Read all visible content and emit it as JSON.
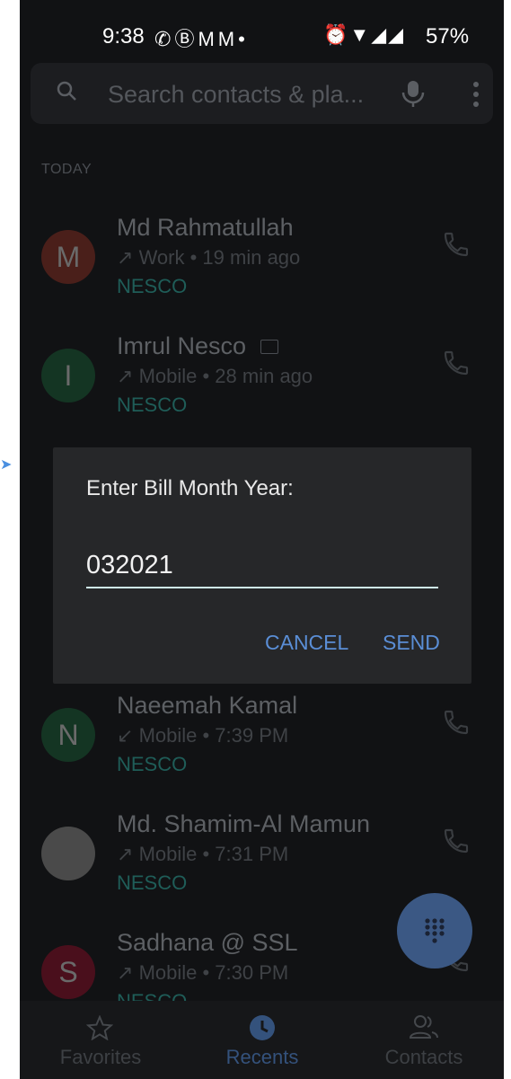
{
  "status_bar": {
    "time": "9:38",
    "battery": "57%",
    "left_icons": [
      "whatsapp-icon",
      "b-icon",
      "gmail-icon",
      "gmail-icon",
      "dot-icon"
    ],
    "right_icons": [
      "alarm-icon",
      "wifi-icon",
      "signal-icon",
      "signal-icon"
    ]
  },
  "search": {
    "placeholder": "Search contacts & pla..."
  },
  "section_label": "TODAY",
  "calls": [
    {
      "avatar_letter": "M",
      "avatar_color": "#4a1f1a",
      "name": "Md Rahmatullah",
      "direction": "↗",
      "detail": "Work • 19 min ago",
      "tag": "NESCO"
    },
    {
      "avatar_letter": "I",
      "avatar_color": "#143523",
      "name": "Imrul Nesco",
      "direction": "↗",
      "detail": "Mobile • 28 min ago",
      "tag": "NESCO"
    },
    {
      "avatar_letter": "N",
      "avatar_color": "#143523",
      "name": "Naeemah Kamal",
      "direction": "↙",
      "detail": "Mobile • 7:39 PM",
      "tag": "NESCO"
    },
    {
      "avatar_letter": "",
      "avatar_color": "#4a4a4a",
      "name": "Md. Shamim-Al Mamun",
      "direction": "↗",
      "detail": "Mobile • 7:31 PM",
      "tag": "NESCO"
    },
    {
      "avatar_letter": "S",
      "avatar_color": "#4a0f1c",
      "name": "Sadhana @ SSL",
      "direction": "↗",
      "detail": "Mobile • 7:30 PM",
      "tag": "NESCO"
    }
  ],
  "dialog": {
    "title": "Enter Bill Month Year:",
    "value": "032021",
    "cancel_label": "CANCEL",
    "send_label": "SEND"
  },
  "bottom_nav": [
    {
      "label": "Favorites",
      "icon": "star-icon",
      "active": false
    },
    {
      "label": "Recents",
      "icon": "clock-icon",
      "active": true
    },
    {
      "label": "Contacts",
      "icon": "people-icon",
      "active": false
    }
  ],
  "colors": {
    "background": "#111214",
    "dialog": "#262729",
    "accent": "#5a8ed6",
    "fab": "#3b5884"
  }
}
